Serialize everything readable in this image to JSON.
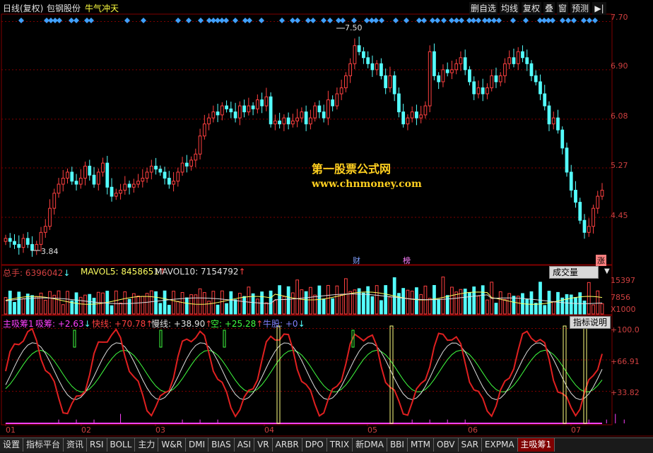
{
  "header": {
    "period": "日线(复权)",
    "stock_name": "包钢股份",
    "formula_name": "牛气冲天",
    "toolbar": [
      "删自选",
      "均线",
      "复权",
      "叠",
      "窗",
      "预测"
    ],
    "nav_icon": "play-arrow-icon"
  },
  "price_axis": [
    "7.70",
    "6.90",
    "6.08",
    "5.27",
    "4.45"
  ],
  "annotations": {
    "high": "7.50",
    "low": "3.84",
    "fin_tag": "财",
    "list_tag": "榜",
    "rise_tag": "涨"
  },
  "watermark": {
    "line1": "第一股票公式网",
    "line2": "www.chnmoney.com"
  },
  "volume_panel": {
    "total_label": "总手: 6396042",
    "mavol5_label": "MAVOL5: 8458651",
    "mavol10_label": "MAVOL10: 7154792",
    "select": "成交量",
    "axis": [
      "15397",
      "7856",
      "X1000"
    ]
  },
  "indicator_panel": {
    "name": "主吸筹1",
    "values": [
      "吸筹: +2.63",
      "快线: +70.78",
      "慢线: +38.90",
      "空: +25.28",
      "牛股: +0"
    ],
    "explain": "指标说明",
    "axis": [
      "+100.0",
      "+66.91",
      "+33.82"
    ]
  },
  "x_axis": [
    "01",
    "02",
    "03",
    "04",
    "05",
    "06",
    "07"
  ],
  "tabs": [
    "设置",
    "指标平台",
    "资讯",
    "RSI",
    "BOLL",
    "主力",
    "W&R",
    "DMI",
    "BIAS",
    "ASI",
    "VR",
    "ARBR",
    "DPO",
    "TRIX",
    "新DMA",
    "BBI",
    "MTM",
    "OBV",
    "SAR",
    "EXPMA",
    "主吸筹1"
  ],
  "active_tab": "主吸筹1",
  "colors": {
    "up": "#ff4040",
    "down": "#54ffff",
    "grid": "#800000",
    "text_red": "#d04040",
    "fast": "#e02020",
    "slow": "#e0e0e0",
    "kong": "#40ff40",
    "xichou": "#ff40ff"
  },
  "chart_data": [
    {
      "type": "candlestick",
      "title": "包钢股份 日线(复权)",
      "x": [
        "01",
        "02",
        "03",
        "04",
        "05",
        "06",
        "07"
      ],
      "ylim": [
        3.7,
        7.8
      ],
      "y_ticks": [
        4.45,
        5.27,
        6.08,
        6.9,
        7.7
      ],
      "high_label": 7.5,
      "low_label": 3.84,
      "closes": [
        4.1,
        4.05,
        4.0,
        3.95,
        4.1,
        4.0,
        3.9,
        4.0,
        4.2,
        4.3,
        4.6,
        4.85,
        5.0,
        5.1,
        5.2,
        5.05,
        5.0,
        5.1,
        5.3,
        5.15,
        5.0,
        5.2,
        5.35,
        4.95,
        4.8,
        4.85,
        4.9,
        5.0,
        4.95,
        5.0,
        5.05,
        5.1,
        5.2,
        5.3,
        5.25,
        5.2,
        5.1,
        5.0,
        5.05,
        5.2,
        5.35,
        5.3,
        5.4,
        5.5,
        5.8,
        6.0,
        6.1,
        6.2,
        6.15,
        6.3,
        6.25,
        6.2,
        6.1,
        6.3,
        6.2,
        6.3,
        6.25,
        6.4,
        6.3,
        6.45,
        6.0,
        6.05,
        6.0,
        6.1,
        6.0,
        6.05,
        6.1,
        6.2,
        6.0,
        6.1,
        6.3,
        6.2,
        6.1,
        6.4,
        6.3,
        6.5,
        6.6,
        6.8,
        7.0,
        7.3,
        7.2,
        7.1,
        7.0,
        6.9,
        7.0,
        6.8,
        6.6,
        6.8,
        6.5,
        6.2,
        6.0,
        6.1,
        6.2,
        6.1,
        6.15,
        6.3,
        7.2,
        6.8,
        6.7,
        6.9,
        6.85,
        6.9,
        7.0,
        7.1,
        6.9,
        6.7,
        6.5,
        6.6,
        6.5,
        6.6,
        6.8,
        6.7,
        6.8,
        7.0,
        7.1,
        7.0,
        7.2,
        7.1,
        7.0,
        6.8,
        6.7,
        6.5,
        6.3,
        6.0,
        6.1,
        5.9,
        5.6,
        5.2,
        4.9,
        4.7,
        4.4,
        4.2,
        4.3,
        4.6,
        4.8,
        4.9
      ]
    },
    {
      "type": "bar",
      "title": "成交量",
      "series": [
        {
          "name": "MAVOL5",
          "values": [
            8458651
          ]
        },
        {
          "name": "MAVOL10",
          "values": [
            7154792
          ]
        }
      ],
      "total": 6396042,
      "y_ticks": [
        7856,
        15397
      ],
      "unit": "X1000"
    },
    {
      "type": "line",
      "title": "主吸筹1",
      "ylim": [
        0,
        110
      ],
      "y_ticks": [
        33.82,
        66.91,
        100.0
      ],
      "series": [
        {
          "name": "吸筹",
          "last": 2.63
        },
        {
          "name": "快线",
          "last": 70.78
        },
        {
          "name": "慢线",
          "last": 38.9
        },
        {
          "name": "空",
          "last": 25.28
        },
        {
          "name": "牛股",
          "last": 0
        }
      ]
    }
  ]
}
